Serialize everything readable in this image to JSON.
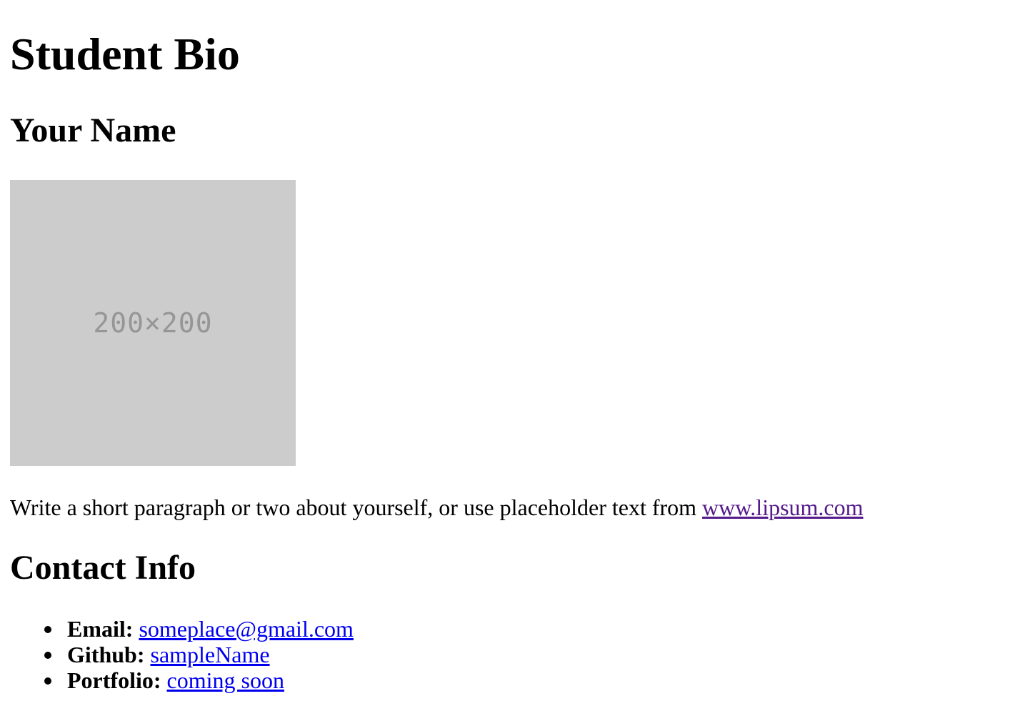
{
  "header": {
    "title": "Student Bio"
  },
  "profile": {
    "name": "Your Name",
    "photo_placeholder": "200×200",
    "bio_text": "Write a short paragraph or two about yourself, or use placeholder text from ",
    "bio_link": "www.lipsum.com"
  },
  "contact": {
    "heading": "Contact Info",
    "items": [
      {
        "label": "Email:",
        "value": "someplace@gmail.com"
      },
      {
        "label": "Github:",
        "value": "sampleName"
      },
      {
        "label": "Portfolio:",
        "value": "coming soon"
      }
    ]
  },
  "colors": {
    "link": "#0000ee",
    "visited_link": "#551a8b",
    "placeholder_bg": "#cccccc",
    "placeholder_text": "#969696"
  }
}
